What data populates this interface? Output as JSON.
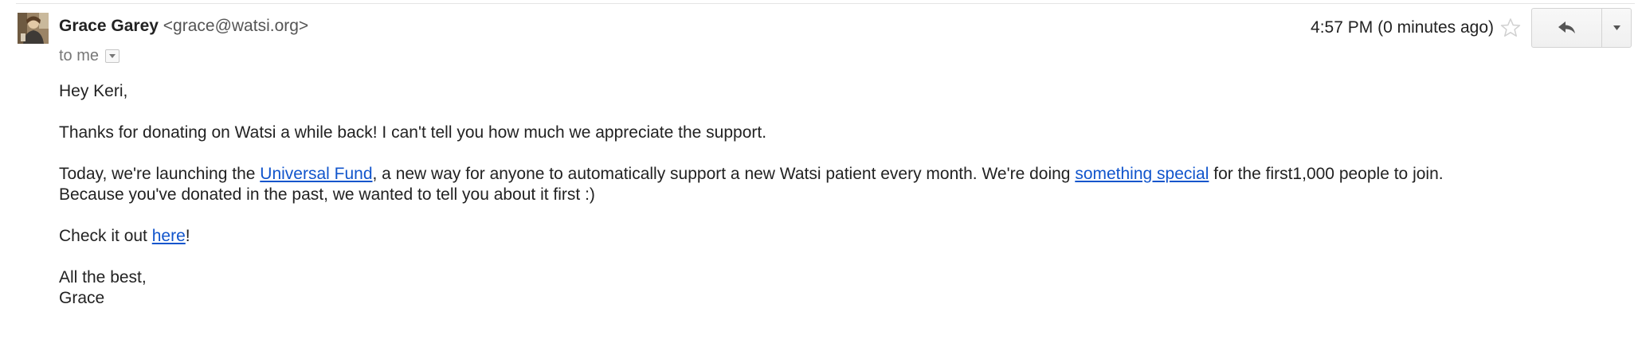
{
  "message": {
    "sender_name": "Grace Garey",
    "sender_email": "<grace@watsi.org>",
    "recipient_line": "to me",
    "timestamp": "4:57 PM (0 minutes ago)",
    "icons": {
      "star": "star-icon",
      "reply": "reply-arrow-icon",
      "more": "caret-down-icon",
      "details_toggle": "caret-down-icon"
    },
    "colors": {
      "link": "#1155cc",
      "text": "#222222",
      "muted": "#777777"
    }
  },
  "body": {
    "greeting": "Hey Keri,",
    "p1": "Thanks for donating on Watsi a while back! I can't tell you how much we appreciate the support.",
    "p2_part1": "Today, we're launching the ",
    "p2_link1": "Universal Fund",
    "p2_part2": ", a new way for anyone to automatically support a new Watsi patient every month. We're doing ",
    "p2_link2": "something special",
    "p2_part3": " for the first1,000 people to join.",
    "p2_line2": "Because you've donated in the past, we wanted to tell you about it first :)",
    "p3_part1": "Check it out ",
    "p3_link": "here",
    "p3_part2": "!",
    "signoff": "All the best,",
    "signature": "Grace"
  }
}
